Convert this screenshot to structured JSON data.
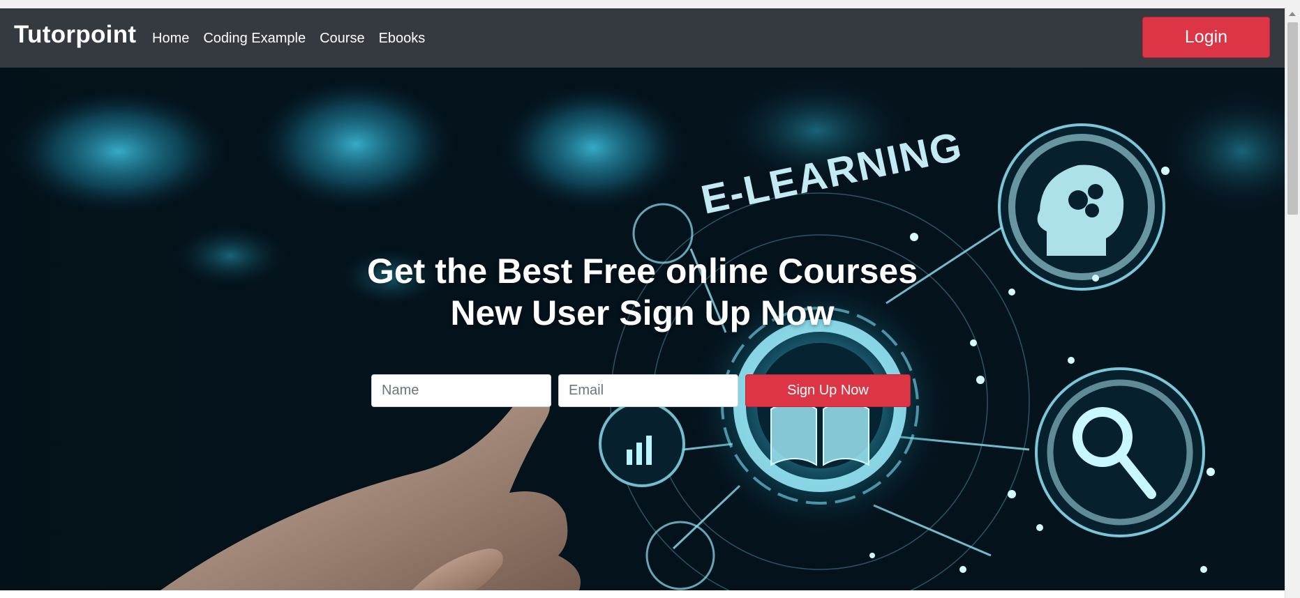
{
  "navbar": {
    "brand": "Tutorpoint",
    "links": [
      "Home",
      "Coding Example",
      "Course",
      "Ebooks"
    ],
    "login_label": "Login"
  },
  "hero": {
    "background_image_text": "E-LEARNING",
    "headline_line1": "Get the Best Free online Courses",
    "headline_line2": "New User Sign Up Now",
    "name_placeholder": "Name",
    "email_placeholder": "Email",
    "signup_label": "Sign Up Now"
  },
  "colors": {
    "navbar_bg": "#343a40",
    "accent_red": "#dc3545",
    "hero_glow": "#3ec9e8"
  },
  "icons": [
    "head-gears-icon",
    "magnifier-icon",
    "book-icon",
    "bar-chart-icon"
  ]
}
